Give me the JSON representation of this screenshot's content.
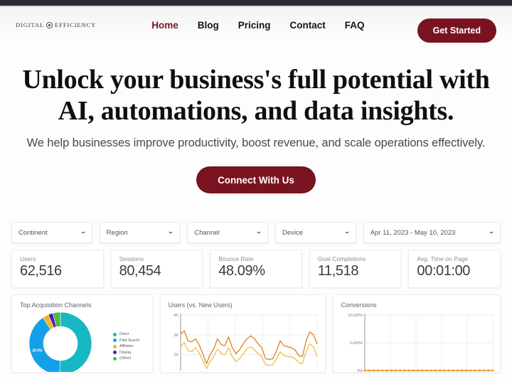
{
  "nav": {
    "logo_left": "DIGITAL",
    "logo_right": "EFFICIENCY",
    "logo_icon": "gear-circle-icon",
    "links": [
      {
        "label": "Home",
        "active": true
      },
      {
        "label": "Blog",
        "active": false
      },
      {
        "label": "Pricing",
        "active": false
      },
      {
        "label": "Contact",
        "active": false
      },
      {
        "label": "FAQ",
        "active": false
      }
    ],
    "cta_label": "Get Started"
  },
  "hero": {
    "title": "Unlock your business's full potential with AI, automations, and data insights.",
    "subtitle": "We help businesses improve productivity, boost revenue, and scale operations effectively.",
    "cta_label": "Connect With Us"
  },
  "dashboard": {
    "filters": [
      {
        "label": "Continent"
      },
      {
        "label": "Region"
      },
      {
        "label": "Channel"
      },
      {
        "label": "Device"
      },
      {
        "label": "Apr 11, 2023 - May 10, 2023"
      }
    ],
    "kpis": [
      {
        "label": "Users",
        "value": "62,516"
      },
      {
        "label": "Sessions",
        "value": "80,454"
      },
      {
        "label": "Bounce Rate",
        "value": "48.09%"
      },
      {
        "label": "Goal Completions",
        "value": "11,518"
      },
      {
        "label": "Avg. Time on Page",
        "value": "00:01:00"
      }
    ],
    "panels": [
      {
        "title": "Top Acquisition Channels"
      },
      {
        "title": "Users (vs. New Users)"
      },
      {
        "title": "Conversions"
      }
    ]
  },
  "colors": {
    "brand_maroon": "#7a1320",
    "nav_active": "#7d1420",
    "donut_direct": "#17b8c4",
    "donut_paid_search": "#14a0e8",
    "donut_affiliates": "#f0b323",
    "donut_display": "#4b1fa8",
    "donut_other": "#4cb947",
    "line_users": "#e08020",
    "line_new_users": "#edc04a"
  },
  "chart_data": [
    {
      "type": "pie",
      "title": "Top Acquisition Channels",
      "legend_position": "right",
      "categories": [
        "Direct",
        "Paid Search",
        "Affiliates",
        "Display",
        "(Other)"
      ],
      "values": [
        50.4,
        40.1,
        3.2,
        2.4,
        3.9
      ],
      "labels": [
        "",
        "28.9%",
        "",
        "",
        ""
      ],
      "colors": [
        "#17b8c4",
        "#14a0e8",
        "#f0b323",
        "#4b1fa8",
        "#4cb947"
      ]
    },
    {
      "type": "line",
      "title": "Users (vs. New Users)",
      "xlabel": "",
      "ylabel": "",
      "ylim": [
        1200,
        4000
      ],
      "yticks": [
        "4K",
        "3K",
        "2K"
      ],
      "grid": true,
      "series": [
        {
          "name": "Users",
          "color": "#e08020",
          "values": [
            3050,
            3200,
            2700,
            2650,
            2800,
            2500,
            2050,
            1550,
            2000,
            2300,
            2800,
            2500,
            2450,
            2900,
            2350,
            2050,
            2250,
            2550,
            2800,
            2950,
            2800,
            2550,
            2350,
            1800,
            1750,
            1800,
            2200,
            2700,
            2450,
            2400,
            2350,
            2250,
            1950,
            1900,
            2700,
            3150,
            3000,
            2550
          ]
        },
        {
          "name": "New Users",
          "color": "#edc04a",
          "values": [
            2400,
            2600,
            2200,
            2150,
            2350,
            2100,
            1700,
            1300,
            1650,
            1900,
            2300,
            2050,
            2000,
            2350,
            1900,
            1650,
            1800,
            2050,
            2300,
            2400,
            2250,
            2050,
            1900,
            1500,
            1450,
            1500,
            1800,
            2150,
            1950,
            1900,
            1900,
            1800,
            1600,
            1550,
            2150,
            2550,
            2400,
            1900
          ]
        }
      ]
    },
    {
      "type": "line",
      "title": "Conversions",
      "xlabel": "",
      "ylabel": "",
      "ylim": [
        0,
        10000
      ],
      "yticks": [
        "10,000%",
        "5,000%",
        "0%"
      ],
      "grid": true,
      "series": [
        {
          "name": "Conversions",
          "color": "#e89a2c",
          "marker": "circle",
          "values": [
            0,
            0,
            0,
            0,
            0,
            0,
            0,
            0,
            0,
            0,
            0,
            0,
            0,
            0,
            0,
            0,
            0,
            0,
            0,
            0,
            0,
            0,
            0,
            0,
            0,
            0,
            0,
            0,
            0,
            0
          ]
        }
      ]
    }
  ]
}
